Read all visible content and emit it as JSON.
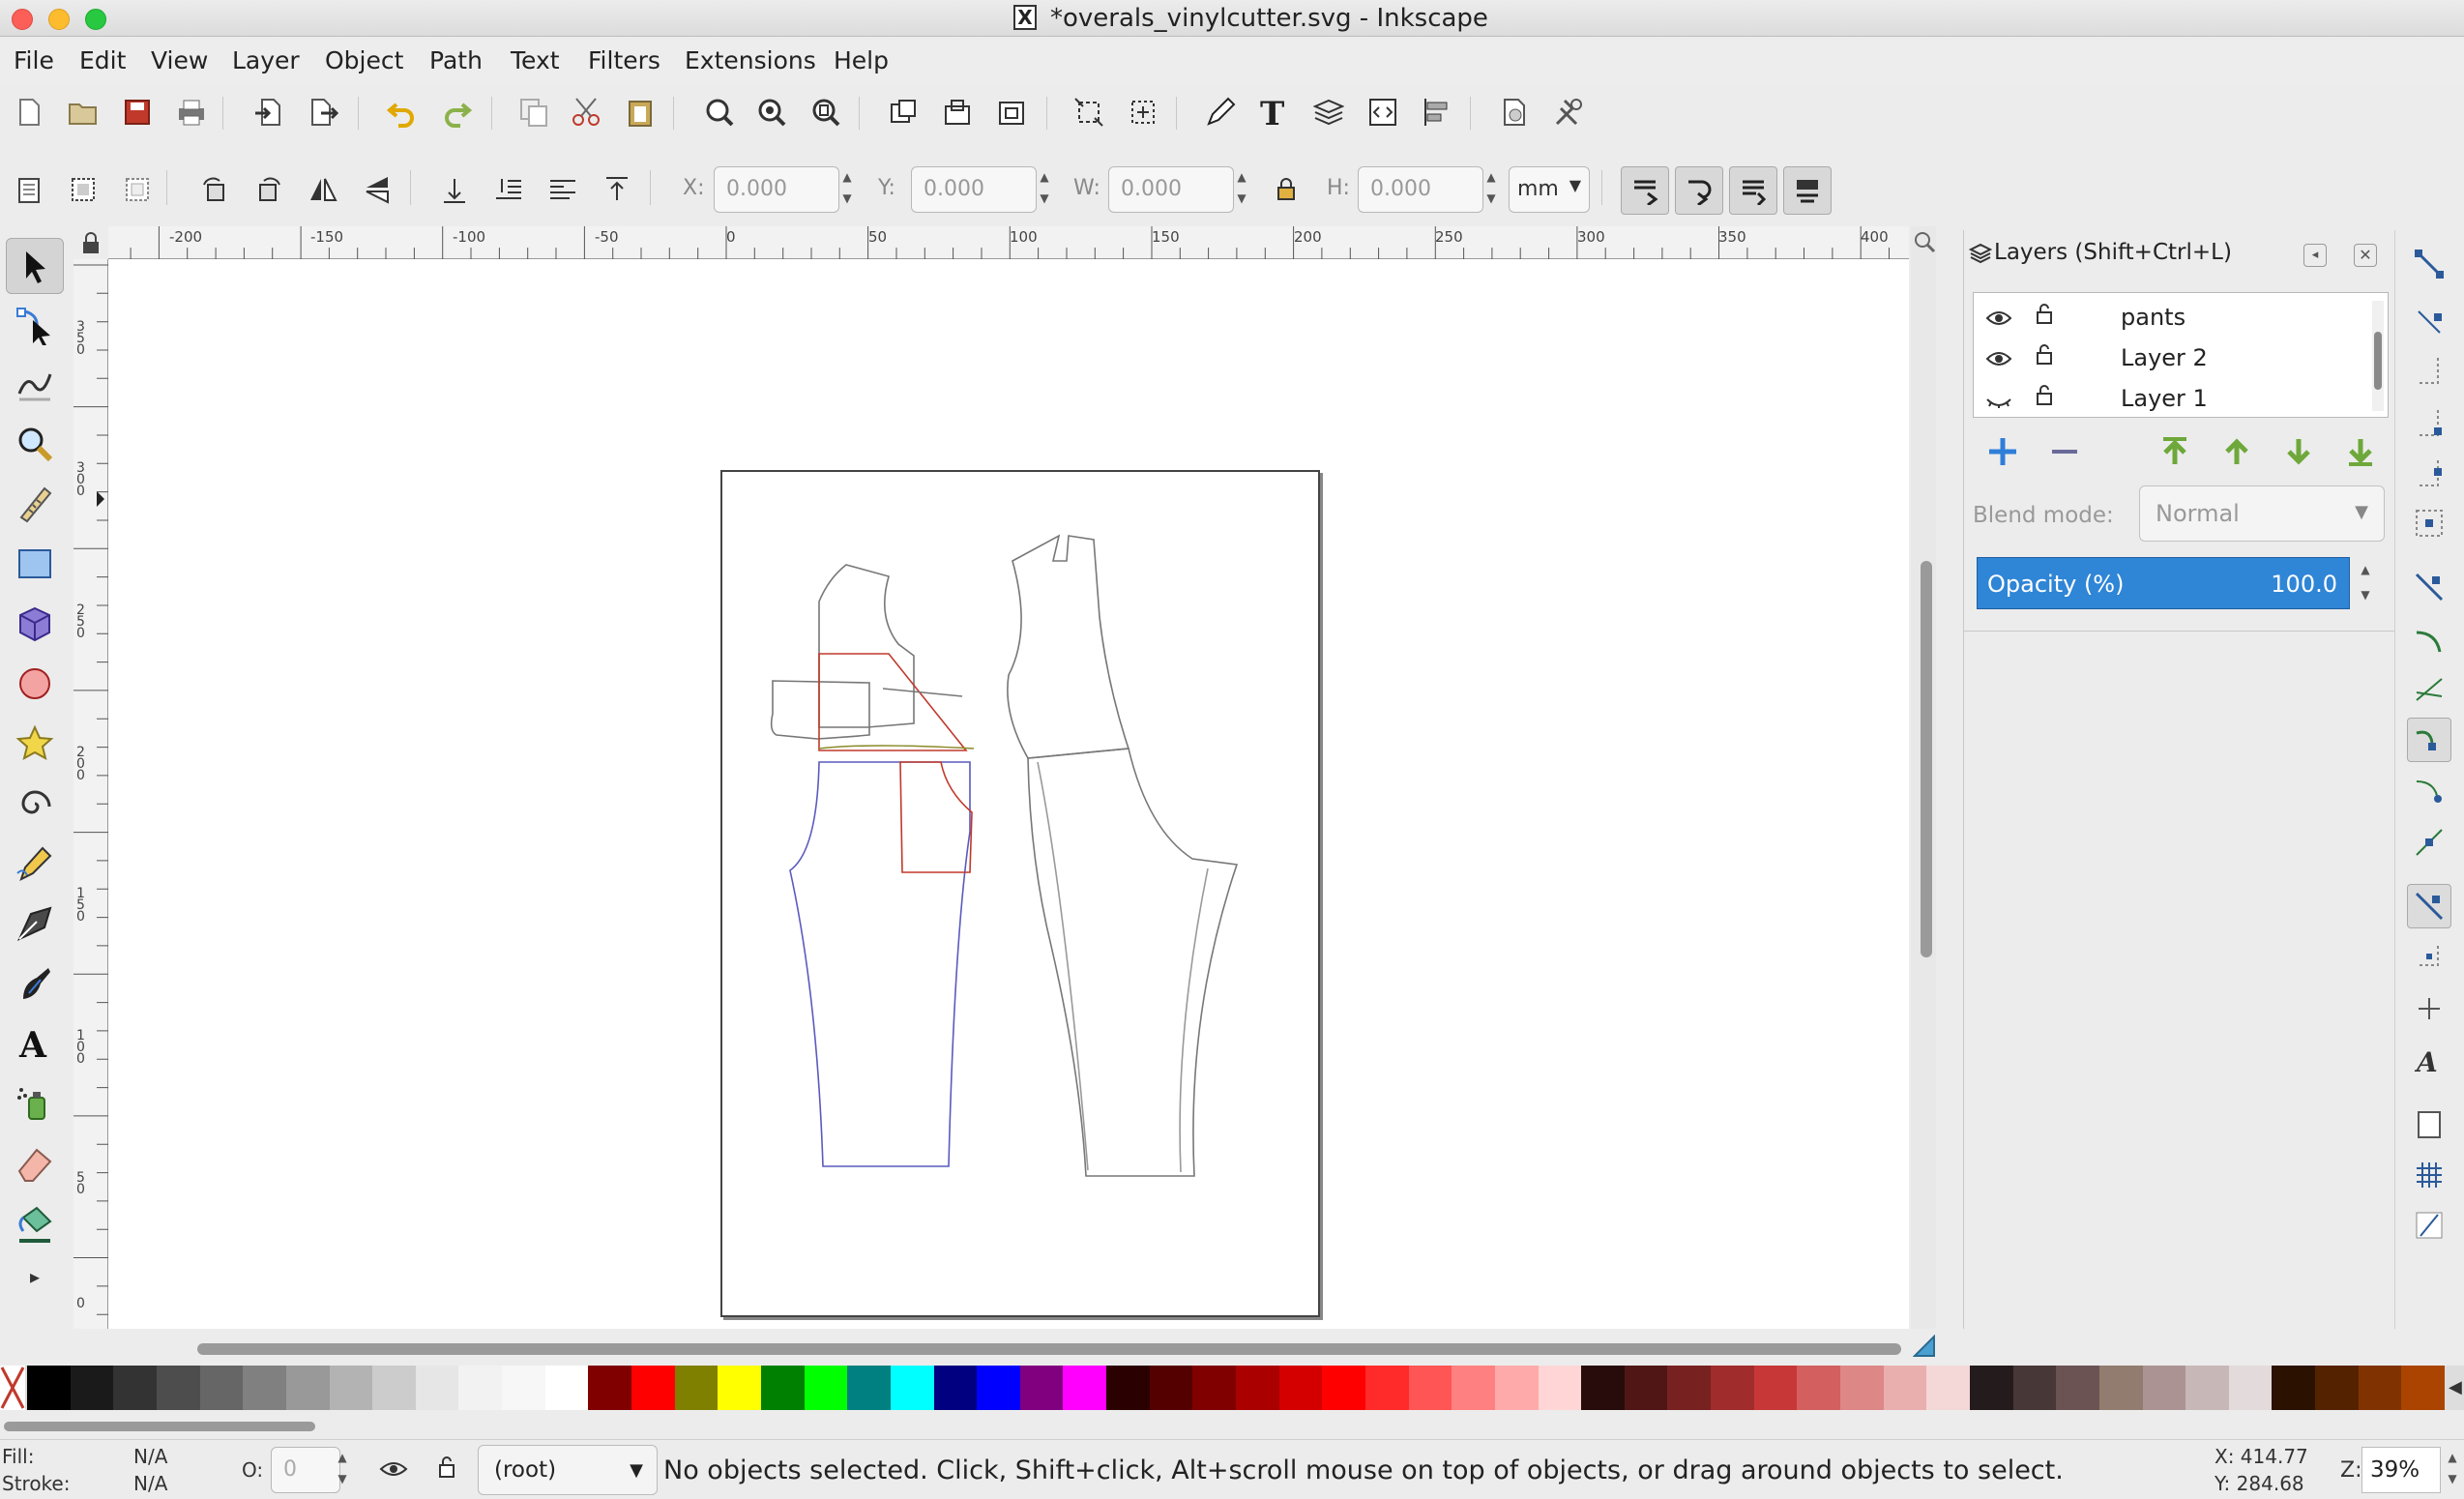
{
  "window": {
    "title": "*overals_vinylcutter.svg - Inkscape",
    "x11_badge": "X"
  },
  "menubar": {
    "items": [
      "File",
      "Edit",
      "View",
      "Layer",
      "Object",
      "Path",
      "Text",
      "Filters",
      "Extensions",
      "Help"
    ]
  },
  "commands_bar": {
    "icons": [
      "new-document-icon",
      "open-icon",
      "save-icon",
      "print-icon",
      "import-icon",
      "export-icon",
      "undo-icon",
      "redo-icon",
      "duplicate-icon",
      "cut-icon",
      "paste-icon",
      "zoom-selection-icon",
      "zoom-drawing-icon",
      "zoom-page-icon",
      "group-icon",
      "lock-layer-icon",
      "unlock-icon",
      "transform-dialog-icon",
      "snap-dialog-icon",
      "xml-editor-pen-icon",
      "text-font-icon",
      "layers-dialog-icon",
      "xml-editor-icon",
      "align-dialog-icon",
      "document-properties-icon",
      "preferences-icon"
    ]
  },
  "tool_controls": {
    "x_label": "X:",
    "x_value": "0.000",
    "y_label": "Y:",
    "y_value": "0.000",
    "w_label": "W:",
    "w_value": "0.000",
    "h_label": "H:",
    "h_value": "0.000",
    "unit": "mm",
    "icons": [
      "select-all-icon",
      "select-all-layers-icon",
      "deselect-icon",
      "rotate-ccw-icon",
      "rotate-cw-icon",
      "flip-horizontal-icon",
      "flip-vertical-icon",
      "raise-to-top-icon",
      "raise-icon",
      "lower-icon",
      "lower-to-bottom-icon",
      "lock-ratio-icon",
      "scale-stroke-icon",
      "scale-corners-icon",
      "transform-gradients-icon",
      "transform-patterns-icon"
    ]
  },
  "rulers": {
    "h_labels": [
      "-200",
      "-150",
      "-100",
      "-50",
      "0",
      "50",
      "100",
      "150",
      "200",
      "250",
      "300",
      "350",
      "400"
    ],
    "v_labels": [
      "350",
      "300",
      "250",
      "200",
      "150",
      "100",
      "50",
      "0"
    ]
  },
  "toolbox": {
    "tools": [
      "selector-tool-icon",
      "node-tool-icon",
      "tweak-tool-icon",
      "zoom-tool-icon",
      "measure-tool-icon",
      "rectangle-tool-icon",
      "3d-box-tool-icon",
      "ellipse-tool-icon",
      "star-tool-icon",
      "spiral-tool-icon",
      "pencil-tool-icon",
      "pen-tool-icon",
      "calligraphy-tool-icon",
      "text-tool-icon",
      "spray-tool-icon",
      "eraser-tool-icon",
      "paint-bucket-tool-icon",
      "more-tools-icon"
    ]
  },
  "layers_panel": {
    "title": "Layers (Shift+Ctrl+L)",
    "layers": [
      {
        "name": "pants",
        "visible": true,
        "locked": false
      },
      {
        "name": "Layer 2",
        "visible": true,
        "locked": false
      },
      {
        "name": "Layer 1",
        "visible": false,
        "locked": false
      }
    ],
    "blend_label": "Blend mode:",
    "blend_value": "Normal",
    "opacity_label": "Opacity (%)",
    "opacity_value": "100.0"
  },
  "palette": {
    "colors": [
      "#000000",
      "#1a1a1a",
      "#333333",
      "#4d4d4d",
      "#666666",
      "#808080",
      "#999999",
      "#b3b3b3",
      "#cccccc",
      "#e6e6e6",
      "#f2f2f2",
      "#f7f7f7",
      "#ffffff",
      "#800000",
      "#ff0000",
      "#808000",
      "#ffff00",
      "#008000",
      "#00ff00",
      "#008080",
      "#00ffff",
      "#000080",
      "#0000ff",
      "#800080",
      "#ff00ff",
      "#2b0000",
      "#550000",
      "#800000",
      "#aa0000",
      "#d40000",
      "#ff0000",
      "#ff2a2a",
      "#ff5555",
      "#ff8080",
      "#ffaaaa",
      "#ffd5d5",
      "#280b0b",
      "#501616",
      "#782121",
      "#a02c2c",
      "#c83737",
      "#d35f5f",
      "#de8787",
      "#e9afaf",
      "#f4d7d7",
      "#241c1c",
      "#483737",
      "#6c5353",
      "#917c6f",
      "#ac9393",
      "#c8b7b7",
      "#e3dbdb",
      "#2b1100",
      "#552200",
      "#803300",
      "#aa4400"
    ]
  },
  "statusbar": {
    "fill_label": "Fill:",
    "fill_value": "N/A",
    "stroke_label": "Stroke:",
    "stroke_value": "N/A",
    "opacity_label": "O:",
    "opacity_value": "0",
    "layer": "(root)",
    "message": "No objects selected. Click, Shift+click, Alt+scroll mouse on top of objects, or drag around objects to select.",
    "cursor_x": "X: 414.77",
    "cursor_y": "Y: 284.68",
    "zoom_label": "Z:",
    "zoom_value": "39%"
  }
}
